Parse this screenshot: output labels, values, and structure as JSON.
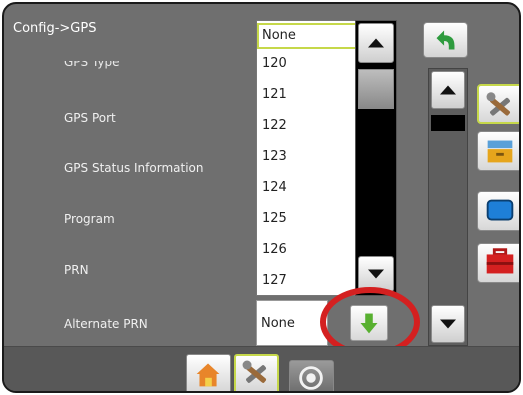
{
  "header": {
    "title": "Config->GPS"
  },
  "settings": {
    "partial_row_label": "GPS Type",
    "rows": [
      {
        "label": "GPS Port"
      },
      {
        "label": "GPS Status Information"
      },
      {
        "label": "Program"
      },
      {
        "label": "PRN"
      },
      {
        "label": "Alternate PRN"
      }
    ]
  },
  "prn_dropdown": {
    "options": [
      "None",
      "120",
      "121",
      "122",
      "123",
      "124",
      "125",
      "126",
      "127"
    ],
    "selected": "None"
  },
  "alternate_prn": {
    "value": "None"
  },
  "icons": {
    "back": "back-arrow-icon",
    "scroll_up": "up-arrow-icon",
    "scroll_down": "down-arrow-icon",
    "open_dropdown": "green-down-arrow-icon",
    "side_tools": "tools-icon",
    "side_data": "file-drawer-icon",
    "side_display": "display-icon",
    "side_kit": "toolbox-icon",
    "bottom_home": "home-icon",
    "bottom_tools": "tools-icon",
    "bottom_gauge": "gauge-icon"
  },
  "colors": {
    "background": "#6f6f6f",
    "selection_outline": "#c6d84a",
    "highlight_ring": "#d42020",
    "back_arrow": "#2e9b3e",
    "dropdown_arrow": "#58b030"
  }
}
